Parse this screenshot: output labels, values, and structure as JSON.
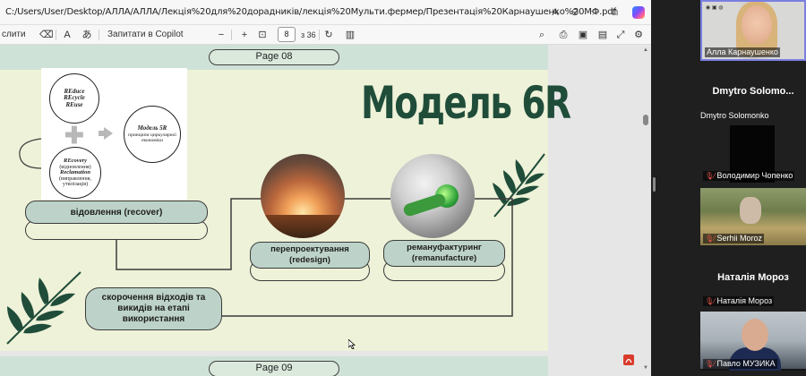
{
  "browser": {
    "url": "C:/Users/User/Desktop/АЛЛА/АЛЛА/Лекція%20для%20дорадників/лекція%20Мульти.фермер/Презентація%20Карнаушенко%20МФ.pdf",
    "copilot_icon": "copilot-icon"
  },
  "pdf_toolbar": {
    "cut_label": "слити",
    "ask_copilot": "Запитати в Copilot",
    "zoom_out": "−",
    "zoom_in": "+",
    "current_page": "8",
    "total_pages": "з 36"
  },
  "page8": {
    "label": "Page 08",
    "title": "Модель 6R",
    "diagram": {
      "reduce_lines": [
        "REduce",
        "REcycle",
        "REuse"
      ],
      "recovery": "REcovery",
      "recovery_sub": "(відновлення)",
      "reclamation": "Reclamation",
      "reclamation_sub": "(виправлення, утилізація)",
      "model_title": "Модель 5R",
      "model_sub": "принципи циркулярної економіки"
    },
    "steps": {
      "recover": "відовлення (recover)",
      "redesign_line1": "перепроектування",
      "redesign_line2": "(redesign)",
      "remanufacture_line1": "ремануфактуринг",
      "remanufacture_line2": "(remanufacture)",
      "reduce_line1": "скорочення відходів та",
      "reduce_line2": "викидів на етапі",
      "reduce_line3": "використання"
    }
  },
  "page9": {
    "label": "Page 09"
  },
  "teams": {
    "participants": [
      {
        "name": "Алла Карнаушенко",
        "center": "",
        "muted": false
      },
      {
        "name": "Dmytro Solomonko",
        "center": "Dmytro  Solomo...",
        "muted": false
      },
      {
        "name": "Володимир Чопенко",
        "center": "",
        "muted": true
      },
      {
        "name": "Serhii Moroz",
        "center": "",
        "muted": true
      },
      {
        "name": "Наталія Мороз",
        "center": "Наталія Мороз",
        "muted": true
      },
      {
        "name": "Павло МУЗИКА",
        "center": "",
        "muted": true
      }
    ]
  },
  "colors": {
    "slide_bg": "#eef2d8",
    "slide_header": "#cfe2d7",
    "pill_fill": "#bdd3c9",
    "title_green": "#1f4d3a",
    "speaker_border": "#7a7fe0"
  }
}
